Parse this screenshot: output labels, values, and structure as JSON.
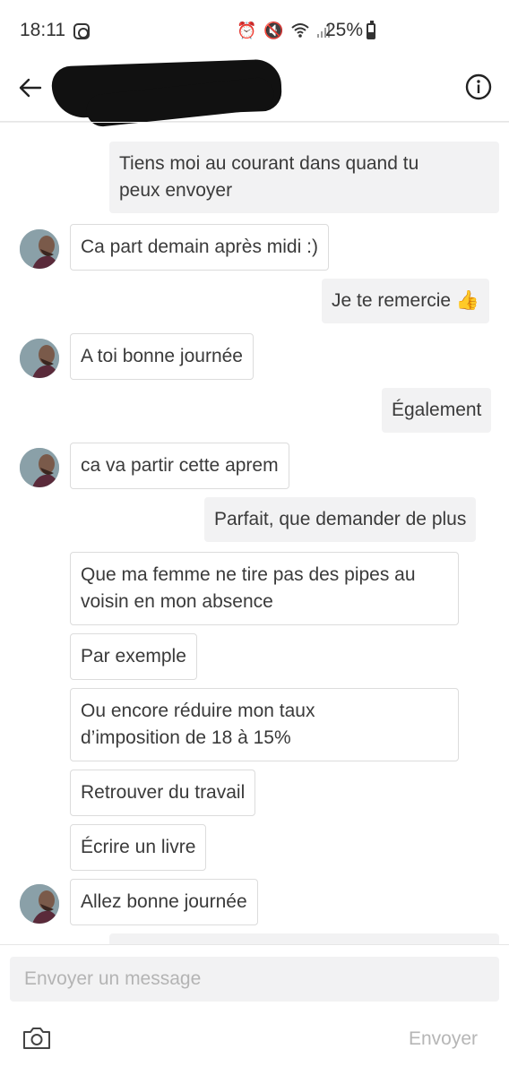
{
  "status_bar": {
    "time": "18:11",
    "battery": "25%",
    "icons": [
      "instagram-icon",
      "alarm-icon",
      "mute-icon",
      "wifi-icon",
      "signal-icon",
      "battery-icon"
    ]
  },
  "header": {
    "icons": [
      "back-arrow-icon",
      "info-icon"
    ]
  },
  "messages": [
    {
      "side": "out",
      "text_lines": [
        "Tiens moi au courant dans quand tu",
        "peux envoyer"
      ]
    },
    {
      "side": "in",
      "avatar": true,
      "text_lines": [
        "Ca part demain après midi :)"
      ]
    },
    {
      "side": "out",
      "text_lines": [
        "Je te remercie 👍"
      ]
    },
    {
      "side": "in",
      "avatar": true,
      "text_lines": [
        "A toi bonne journée"
      ]
    },
    {
      "side": "out",
      "text_lines": [
        "Également"
      ]
    },
    {
      "side": "in",
      "avatar": true,
      "text_lines": [
        "ca va partir cette aprem"
      ]
    },
    {
      "side": "out",
      "text_lines": [
        "Parfait, que demander de plus"
      ]
    },
    {
      "side": "in",
      "avatar": false,
      "text_lines": [
        "Que ma femme ne tire pas des pipes au",
        "voisin en mon absence"
      ]
    },
    {
      "side": "in",
      "avatar": false,
      "text_lines": [
        "Par exemple"
      ]
    },
    {
      "side": "in",
      "avatar": false,
      "text_lines": [
        "Ou encore réduire mon taux",
        "d’imposition de 18 à 15%"
      ]
    },
    {
      "side": "in",
      "avatar": false,
      "text_lines": [
        "Retrouver du travail"
      ]
    },
    {
      "side": "in",
      "avatar": false,
      "text_lines": [
        "Écrire un livre"
      ]
    },
    {
      "side": "in",
      "avatar": true,
      "text_lines": [
        "Allez bonne journée"
      ]
    }
  ],
  "composer": {
    "placeholder": "Envoyer un message",
    "send_label": "Envoyer",
    "icons": [
      "camera-icon"
    ]
  },
  "colors": {
    "outgoing_bubble": "#f2f2f3",
    "incoming_border": "#dcdcdc",
    "text": "#3a3a3a",
    "placeholder": "#b4b4b4"
  }
}
